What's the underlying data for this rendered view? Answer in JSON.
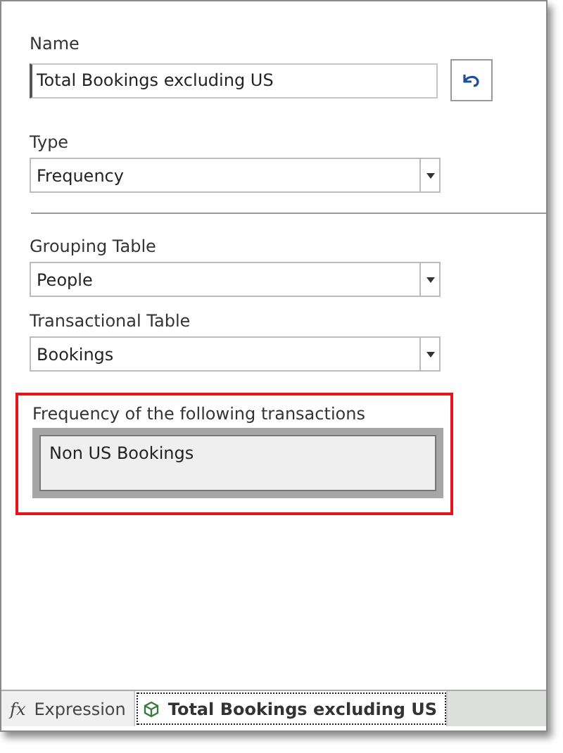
{
  "name_field": {
    "label": "Name",
    "value": "Total Bookings excluding US"
  },
  "type_field": {
    "label": "Type",
    "value": "Frequency"
  },
  "table_fields": [
    {
      "label": "Grouping Table",
      "value": "People"
    },
    {
      "label": "Transactional Table",
      "value": "Bookings"
    }
  ],
  "transactions": {
    "label": "Frequency of the following transactions",
    "highlighted": true,
    "items": [
      "Non US Bookings"
    ]
  },
  "tabs": [
    {
      "kind": "formula",
      "icon_text": "fx",
      "label": "Expression",
      "selected": false
    },
    {
      "kind": "cube",
      "label": "Total Bookings excluding US",
      "selected": true
    }
  ]
}
